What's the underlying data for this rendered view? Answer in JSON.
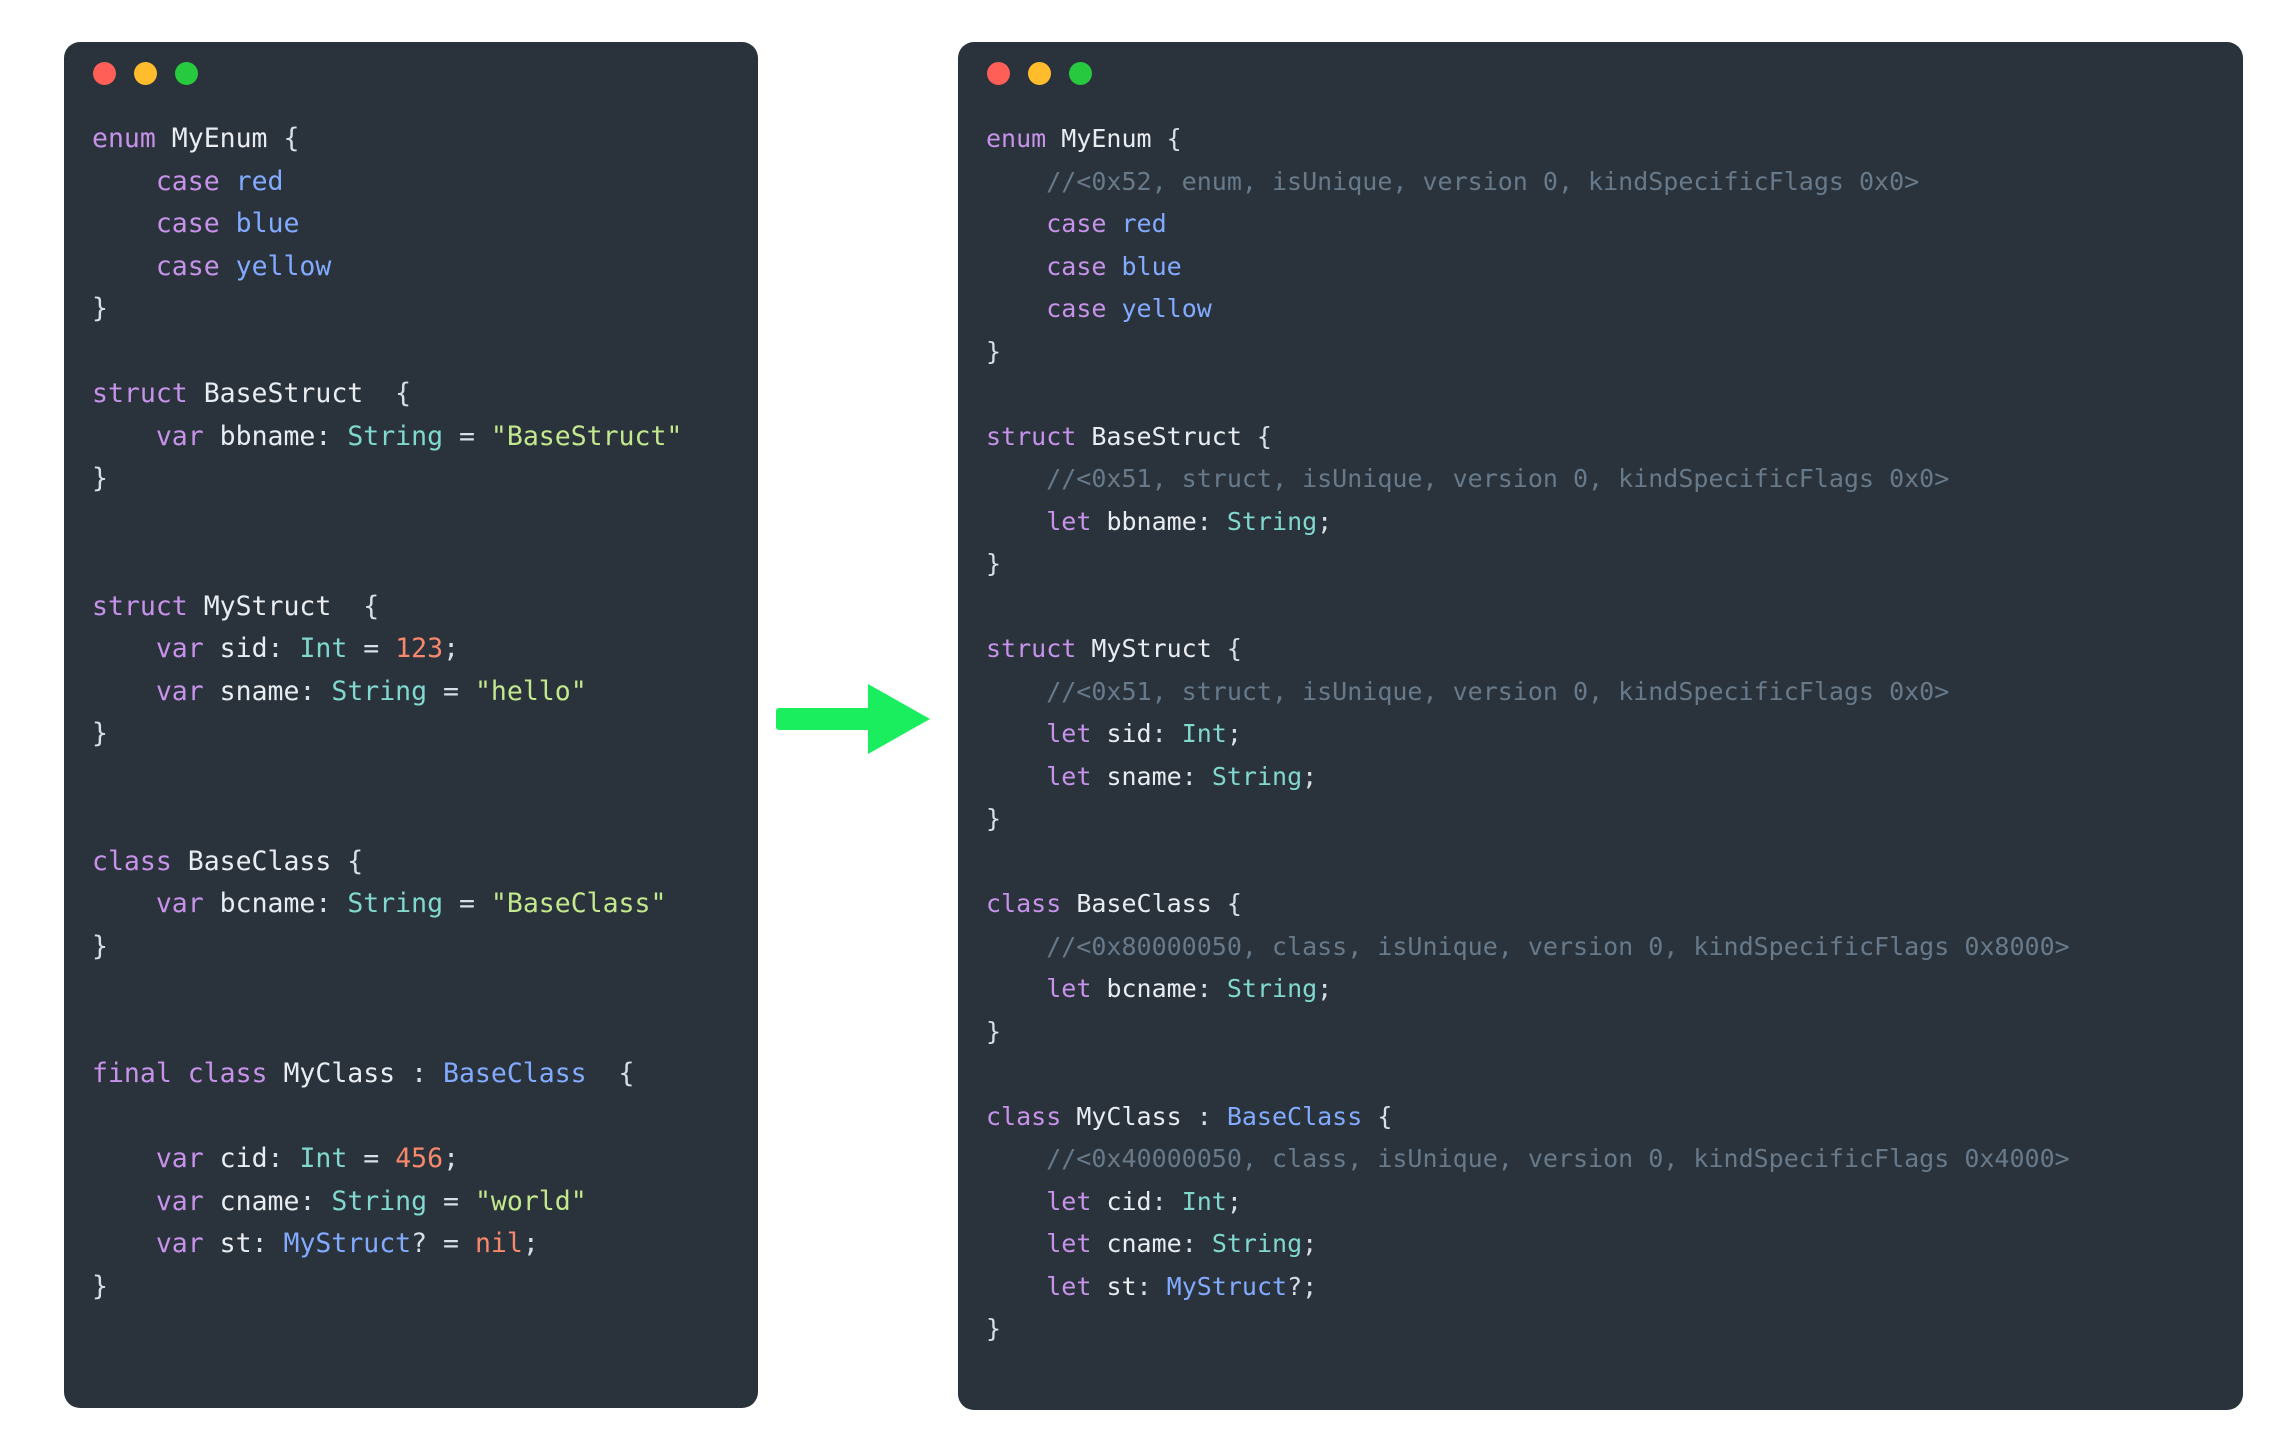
{
  "page": {
    "background": "#ffffff",
    "description": "Side-by-side Swift source comparison: original declarations (left) transformed into reflected/metadata form (right)"
  },
  "colors": {
    "card_background": "#2a333b",
    "keyword": "#c792ea",
    "identifier": "#e9edf2",
    "type": "#80d8cf",
    "reference": "#82aaff",
    "string": "#c3e88d",
    "number": "#f7886c",
    "comment": "#68798a",
    "punctuation": "#d8dee6",
    "arrow": "#1aed5e",
    "traffic_red": "#ff5f56",
    "traffic_yellow": "#ffbd2e",
    "traffic_green": "#27c93f"
  },
  "arrow": {
    "icon": "right-arrow-icon",
    "direction": "right",
    "color": "#1aed5e"
  },
  "left_window": {
    "traffic_lights": [
      "close",
      "minimize",
      "zoom"
    ],
    "lines": [
      {
        "tokens": [
          {
            "t": "enum ",
            "c": "kw"
          },
          {
            "t": "MyEnum",
            "c": "name"
          },
          {
            "t": " {",
            "c": "punc"
          }
        ]
      },
      {
        "tokens": [
          {
            "t": "    ",
            "c": "punc"
          },
          {
            "t": "case ",
            "c": "kw"
          },
          {
            "t": "red",
            "c": "ref"
          }
        ]
      },
      {
        "tokens": [
          {
            "t": "    ",
            "c": "punc"
          },
          {
            "t": "case ",
            "c": "kw"
          },
          {
            "t": "blue",
            "c": "ref"
          }
        ]
      },
      {
        "tokens": [
          {
            "t": "    ",
            "c": "punc"
          },
          {
            "t": "case ",
            "c": "kw"
          },
          {
            "t": "yellow",
            "c": "ref"
          }
        ]
      },
      {
        "tokens": [
          {
            "t": "}",
            "c": "punc"
          }
        ]
      },
      {
        "tokens": [
          {
            "t": " ",
            "c": "punc"
          }
        ]
      },
      {
        "tokens": [
          {
            "t": "struct ",
            "c": "kw"
          },
          {
            "t": "BaseStruct",
            "c": "name"
          },
          {
            "t": "  {",
            "c": "punc"
          }
        ]
      },
      {
        "tokens": [
          {
            "t": "    ",
            "c": "punc"
          },
          {
            "t": "var ",
            "c": "kw"
          },
          {
            "t": "bbname",
            "c": "name"
          },
          {
            "t": ": ",
            "c": "punc"
          },
          {
            "t": "String",
            "c": "type"
          },
          {
            "t": " = ",
            "c": "punc"
          },
          {
            "t": "\"BaseStruct\"",
            "c": "str"
          }
        ]
      },
      {
        "tokens": [
          {
            "t": "}",
            "c": "punc"
          }
        ]
      },
      {
        "tokens": [
          {
            "t": " ",
            "c": "punc"
          }
        ]
      },
      {
        "tokens": [
          {
            "t": " ",
            "c": "punc"
          }
        ]
      },
      {
        "tokens": [
          {
            "t": "struct ",
            "c": "kw"
          },
          {
            "t": "MyStruct",
            "c": "name"
          },
          {
            "t": "  {",
            "c": "punc"
          }
        ]
      },
      {
        "tokens": [
          {
            "t": "    ",
            "c": "punc"
          },
          {
            "t": "var ",
            "c": "kw"
          },
          {
            "t": "sid",
            "c": "name"
          },
          {
            "t": ": ",
            "c": "punc"
          },
          {
            "t": "Int",
            "c": "type"
          },
          {
            "t": " = ",
            "c": "punc"
          },
          {
            "t": "123",
            "c": "num"
          },
          {
            "t": ";",
            "c": "punc"
          }
        ]
      },
      {
        "tokens": [
          {
            "t": "    ",
            "c": "punc"
          },
          {
            "t": "var ",
            "c": "kw"
          },
          {
            "t": "sname",
            "c": "name"
          },
          {
            "t": ": ",
            "c": "punc"
          },
          {
            "t": "String",
            "c": "type"
          },
          {
            "t": " = ",
            "c": "punc"
          },
          {
            "t": "\"hello\"",
            "c": "str"
          }
        ]
      },
      {
        "tokens": [
          {
            "t": "}",
            "c": "punc"
          }
        ]
      },
      {
        "tokens": [
          {
            "t": " ",
            "c": "punc"
          }
        ]
      },
      {
        "tokens": [
          {
            "t": " ",
            "c": "punc"
          }
        ]
      },
      {
        "tokens": [
          {
            "t": "class ",
            "c": "kw"
          },
          {
            "t": "BaseClass",
            "c": "name"
          },
          {
            "t": " {",
            "c": "punc"
          }
        ]
      },
      {
        "tokens": [
          {
            "t": "    ",
            "c": "punc"
          },
          {
            "t": "var ",
            "c": "kw"
          },
          {
            "t": "bcname",
            "c": "name"
          },
          {
            "t": ": ",
            "c": "punc"
          },
          {
            "t": "String",
            "c": "type"
          },
          {
            "t": " = ",
            "c": "punc"
          },
          {
            "t": "\"BaseClass\"",
            "c": "str"
          }
        ]
      },
      {
        "tokens": [
          {
            "t": "}",
            "c": "punc"
          }
        ]
      },
      {
        "tokens": [
          {
            "t": " ",
            "c": "punc"
          }
        ]
      },
      {
        "tokens": [
          {
            "t": " ",
            "c": "punc"
          }
        ]
      },
      {
        "tokens": [
          {
            "t": "final class ",
            "c": "kw"
          },
          {
            "t": "MyClass",
            "c": "name"
          },
          {
            "t": " : ",
            "c": "punc"
          },
          {
            "t": "BaseClass",
            "c": "ref"
          },
          {
            "t": "  {",
            "c": "punc"
          }
        ]
      },
      {
        "tokens": [
          {
            "t": " ",
            "c": "punc"
          }
        ]
      },
      {
        "tokens": [
          {
            "t": "    ",
            "c": "punc"
          },
          {
            "t": "var ",
            "c": "kw"
          },
          {
            "t": "cid",
            "c": "name"
          },
          {
            "t": ": ",
            "c": "punc"
          },
          {
            "t": "Int",
            "c": "type"
          },
          {
            "t": " = ",
            "c": "punc"
          },
          {
            "t": "456",
            "c": "num"
          },
          {
            "t": ";",
            "c": "punc"
          }
        ]
      },
      {
        "tokens": [
          {
            "t": "    ",
            "c": "punc"
          },
          {
            "t": "var ",
            "c": "kw"
          },
          {
            "t": "cname",
            "c": "name"
          },
          {
            "t": ": ",
            "c": "punc"
          },
          {
            "t": "String",
            "c": "type"
          },
          {
            "t": " = ",
            "c": "punc"
          },
          {
            "t": "\"world\"",
            "c": "str"
          }
        ]
      },
      {
        "tokens": [
          {
            "t": "    ",
            "c": "punc"
          },
          {
            "t": "var ",
            "c": "kw"
          },
          {
            "t": "st",
            "c": "name"
          },
          {
            "t": ": ",
            "c": "punc"
          },
          {
            "t": "MyStruct",
            "c": "ref"
          },
          {
            "t": "? = ",
            "c": "punc"
          },
          {
            "t": "nil",
            "c": "num"
          },
          {
            "t": ";",
            "c": "punc"
          }
        ]
      },
      {
        "tokens": [
          {
            "t": "}",
            "c": "punc"
          }
        ]
      }
    ]
  },
  "right_window": {
    "traffic_lights": [
      "close",
      "minimize",
      "zoom"
    ],
    "lines": [
      {
        "tokens": [
          {
            "t": "enum ",
            "c": "kw"
          },
          {
            "t": "MyEnum",
            "c": "name"
          },
          {
            "t": " {",
            "c": "punc"
          }
        ]
      },
      {
        "tokens": [
          {
            "t": "    //<0x52, enum, isUnique, version 0, kindSpecificFlags 0x0>",
            "c": "cmt"
          }
        ]
      },
      {
        "tokens": [
          {
            "t": "    ",
            "c": "punc"
          },
          {
            "t": "case ",
            "c": "kw"
          },
          {
            "t": "red",
            "c": "ref"
          }
        ]
      },
      {
        "tokens": [
          {
            "t": "    ",
            "c": "punc"
          },
          {
            "t": "case ",
            "c": "kw"
          },
          {
            "t": "blue",
            "c": "ref"
          }
        ]
      },
      {
        "tokens": [
          {
            "t": "    ",
            "c": "punc"
          },
          {
            "t": "case ",
            "c": "kw"
          },
          {
            "t": "yellow",
            "c": "ref"
          }
        ]
      },
      {
        "tokens": [
          {
            "t": "}",
            "c": "punc"
          }
        ]
      },
      {
        "tokens": [
          {
            "t": " ",
            "c": "punc"
          }
        ]
      },
      {
        "tokens": [
          {
            "t": "struct ",
            "c": "kw"
          },
          {
            "t": "BaseStruct",
            "c": "name"
          },
          {
            "t": " {",
            "c": "punc"
          }
        ]
      },
      {
        "tokens": [
          {
            "t": "    //<0x51, struct, isUnique, version 0, kindSpecificFlags 0x0>",
            "c": "cmt"
          }
        ]
      },
      {
        "tokens": [
          {
            "t": "    ",
            "c": "punc"
          },
          {
            "t": "let ",
            "c": "kw"
          },
          {
            "t": "bbname",
            "c": "name"
          },
          {
            "t": ": ",
            "c": "punc"
          },
          {
            "t": "String",
            "c": "type"
          },
          {
            "t": ";",
            "c": "punc"
          }
        ]
      },
      {
        "tokens": [
          {
            "t": "}",
            "c": "punc"
          }
        ]
      },
      {
        "tokens": [
          {
            "t": " ",
            "c": "punc"
          }
        ]
      },
      {
        "tokens": [
          {
            "t": "struct ",
            "c": "kw"
          },
          {
            "t": "MyStruct",
            "c": "name"
          },
          {
            "t": " {",
            "c": "punc"
          }
        ]
      },
      {
        "tokens": [
          {
            "t": "    //<0x51, struct, isUnique, version 0, kindSpecificFlags 0x0>",
            "c": "cmt"
          }
        ]
      },
      {
        "tokens": [
          {
            "t": "    ",
            "c": "punc"
          },
          {
            "t": "let ",
            "c": "kw"
          },
          {
            "t": "sid",
            "c": "name"
          },
          {
            "t": ": ",
            "c": "punc"
          },
          {
            "t": "Int",
            "c": "type"
          },
          {
            "t": ";",
            "c": "punc"
          }
        ]
      },
      {
        "tokens": [
          {
            "t": "    ",
            "c": "punc"
          },
          {
            "t": "let ",
            "c": "kw"
          },
          {
            "t": "sname",
            "c": "name"
          },
          {
            "t": ": ",
            "c": "punc"
          },
          {
            "t": "String",
            "c": "type"
          },
          {
            "t": ";",
            "c": "punc"
          }
        ]
      },
      {
        "tokens": [
          {
            "t": "}",
            "c": "punc"
          }
        ]
      },
      {
        "tokens": [
          {
            "t": " ",
            "c": "punc"
          }
        ]
      },
      {
        "tokens": [
          {
            "t": "class ",
            "c": "kw"
          },
          {
            "t": "BaseClass",
            "c": "name"
          },
          {
            "t": " {",
            "c": "punc"
          }
        ]
      },
      {
        "tokens": [
          {
            "t": "    //<0x80000050, class, isUnique, version 0, kindSpecificFlags 0x8000>",
            "c": "cmt"
          }
        ]
      },
      {
        "tokens": [
          {
            "t": "    ",
            "c": "punc"
          },
          {
            "t": "let ",
            "c": "kw"
          },
          {
            "t": "bcname",
            "c": "name"
          },
          {
            "t": ": ",
            "c": "punc"
          },
          {
            "t": "String",
            "c": "type"
          },
          {
            "t": ";",
            "c": "punc"
          }
        ]
      },
      {
        "tokens": [
          {
            "t": "}",
            "c": "punc"
          }
        ]
      },
      {
        "tokens": [
          {
            "t": " ",
            "c": "punc"
          }
        ]
      },
      {
        "tokens": [
          {
            "t": "class ",
            "c": "kw"
          },
          {
            "t": "MyClass",
            "c": "name"
          },
          {
            "t": " : ",
            "c": "punc"
          },
          {
            "t": "BaseClass",
            "c": "ref"
          },
          {
            "t": " {",
            "c": "punc"
          }
        ]
      },
      {
        "tokens": [
          {
            "t": "    //<0x40000050, class, isUnique, version 0, kindSpecificFlags 0x4000>",
            "c": "cmt"
          }
        ]
      },
      {
        "tokens": [
          {
            "t": "    ",
            "c": "punc"
          },
          {
            "t": "let ",
            "c": "kw"
          },
          {
            "t": "cid",
            "c": "name"
          },
          {
            "t": ": ",
            "c": "punc"
          },
          {
            "t": "Int",
            "c": "type"
          },
          {
            "t": ";",
            "c": "punc"
          }
        ]
      },
      {
        "tokens": [
          {
            "t": "    ",
            "c": "punc"
          },
          {
            "t": "let ",
            "c": "kw"
          },
          {
            "t": "cname",
            "c": "name"
          },
          {
            "t": ": ",
            "c": "punc"
          },
          {
            "t": "String",
            "c": "type"
          },
          {
            "t": ";",
            "c": "punc"
          }
        ]
      },
      {
        "tokens": [
          {
            "t": "    ",
            "c": "punc"
          },
          {
            "t": "let ",
            "c": "kw"
          },
          {
            "t": "st",
            "c": "name"
          },
          {
            "t": ": ",
            "c": "punc"
          },
          {
            "t": "MyStruct",
            "c": "ref"
          },
          {
            "t": "?;",
            "c": "punc"
          }
        ]
      },
      {
        "tokens": [
          {
            "t": "}",
            "c": "punc"
          }
        ]
      }
    ]
  }
}
